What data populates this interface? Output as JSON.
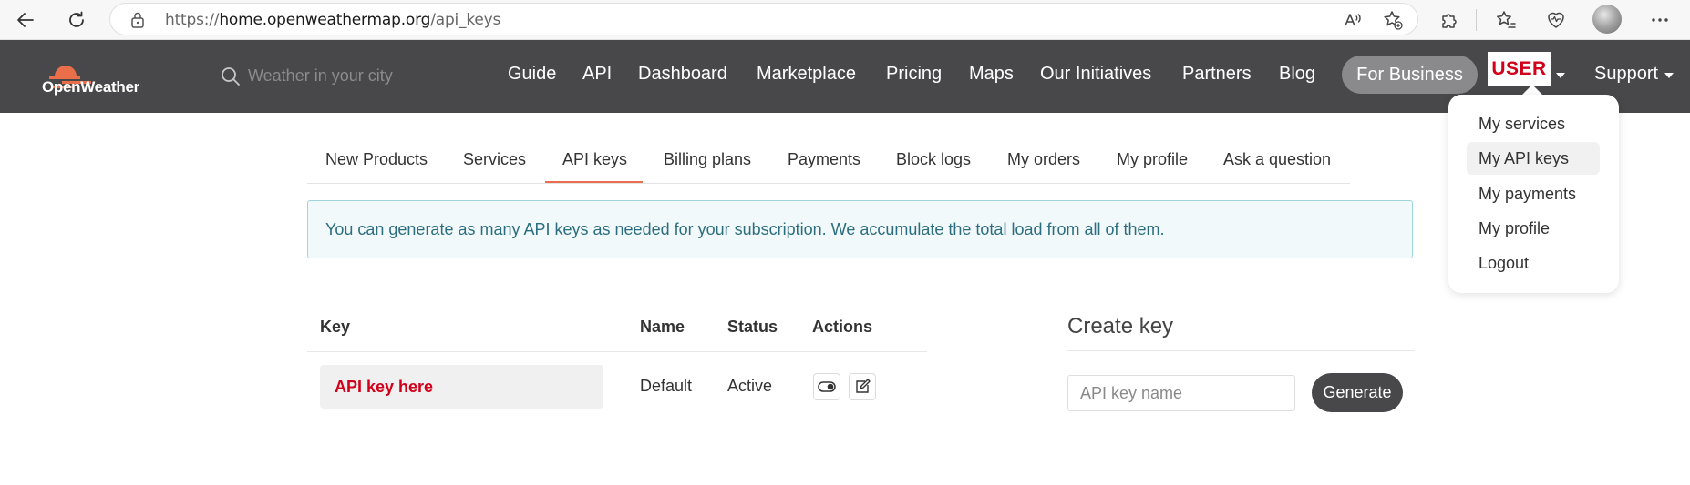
{
  "browser": {
    "url_prefix": "https://",
    "url_host": "home.openweathermap.org",
    "url_path": "/api_keys"
  },
  "header": {
    "logo_text": "OpenWeather",
    "search_placeholder": "Weather in your city",
    "nav": [
      "Guide",
      "API",
      "Dashboard",
      "Marketplace",
      "Pricing",
      "Maps",
      "Our Initiatives",
      "Partners",
      "Blog"
    ],
    "for_business": "For Business",
    "user_label": "USER",
    "support": "Support"
  },
  "user_menu": {
    "items": [
      "My services",
      "My API keys",
      "My payments",
      "My profile",
      "Logout"
    ],
    "active_index": 1
  },
  "tabs": {
    "items": [
      "New Products",
      "Services",
      "API keys",
      "Billing plans",
      "Payments",
      "Block logs",
      "My orders",
      "My profile",
      "Ask a question"
    ],
    "active": "API keys"
  },
  "alert": {
    "text": "You can generate as many API keys as needed for your subscription. We accumulate the total load from all of them."
  },
  "keys_table": {
    "headers": {
      "key": "Key",
      "name": "Name",
      "status": "Status",
      "actions": "Actions"
    },
    "rows": [
      {
        "key": "API key here",
        "name": "Default",
        "status": "Active"
      }
    ]
  },
  "create_key": {
    "title": "Create key",
    "input_placeholder": "API key name",
    "button": "Generate"
  },
  "colors": {
    "header_bg": "#48484a",
    "accent": "#e96e50",
    "key_red": "#d0021b"
  }
}
